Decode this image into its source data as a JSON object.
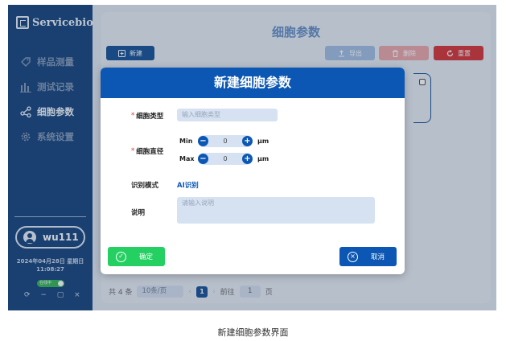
{
  "app": {
    "logo_text": "Servicebio",
    "page_title": "细胞参数",
    "caption": "新建细胞参数界面"
  },
  "sidebar": {
    "items": [
      {
        "label": "样品测量",
        "icon": "tag-icon",
        "active": false
      },
      {
        "label": "测试记录",
        "icon": "bar-chart-icon",
        "active": false
      },
      {
        "label": "细胞参数",
        "icon": "share-icon",
        "active": true
      },
      {
        "label": "系统设置",
        "icon": "gear-icon",
        "active": false
      }
    ],
    "user": "wu111",
    "date": "2024年04月28日 星期日",
    "time": "11:08:27",
    "status": "在线中",
    "window_controls": "⟳ − ▢ ×"
  },
  "toolbar": {
    "new_label": "新建",
    "export_label": "导出",
    "delete_label": "删除",
    "reset_label": "重置"
  },
  "pagination": {
    "total": "共 4 条",
    "page_size": "10条/页",
    "current_page": "1",
    "goto_label": "前往",
    "goto_value": "1",
    "page_unit": "页"
  },
  "dialog": {
    "title": "新建细胞参数",
    "cell_type_label": "细胞类型",
    "cell_type_placeholder": "输入细胞类型",
    "diameter_label": "细胞直径",
    "min_label": "Min",
    "min_value": "0",
    "max_label": "Max",
    "max_value": "0",
    "unit": "μm",
    "mode_label": "识别模式",
    "mode_value": "AI识别",
    "desc_label": "说明",
    "desc_placeholder": "请输入说明",
    "ok_label": "确定",
    "cancel_label": "取消"
  },
  "colors": {
    "sidebar": "#0c3c75",
    "primary": "#0b57b3",
    "success": "#25d062",
    "danger": "#d52c2c"
  }
}
